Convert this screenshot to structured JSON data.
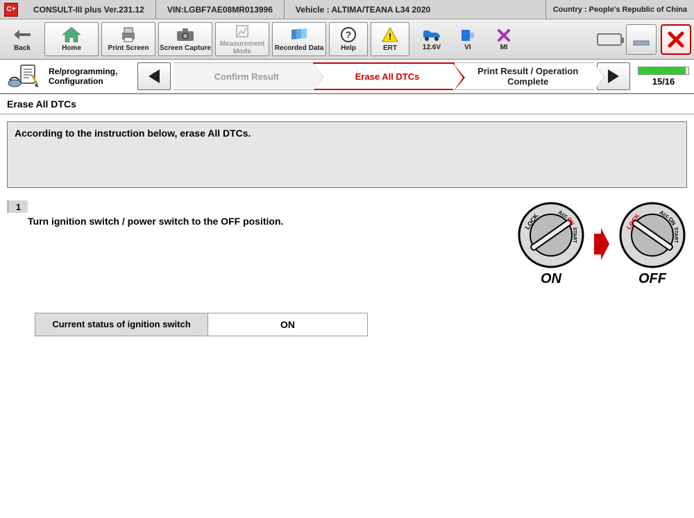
{
  "info_bar": {
    "app_icon": "C+",
    "app_name": "CONSULT-III plus  Ver.231.12",
    "vin": "VIN:LGBF7AE08MR013996",
    "vehicle": "Vehicle : ALTIMA/TEANA L34 2020",
    "country": "Country : People's Republic of China"
  },
  "toolbar": {
    "back": "Back",
    "home": "Home",
    "print_screen": "Print Screen",
    "screen_capture": "Screen Capture",
    "measurement_mode": "Measurement Mode",
    "recorded_data": "Recorded Data",
    "help": "Help",
    "ert": "ERT"
  },
  "status": {
    "voltage": "12.6V",
    "vi": "VI",
    "mi": "MI"
  },
  "wizard": {
    "task_label": "Re/programming, Configuration",
    "step_prev": "Confirm Result",
    "step_current": "Erase All DTCs",
    "step_next": "Print Result / Operation Complete",
    "progress": "15/16",
    "progress_pct": 94
  },
  "section": {
    "title": "Erase All DTCs"
  },
  "instruction": "According to the instruction below, erase All DTCs.",
  "step": {
    "number": "1",
    "text": "Turn ignition switch / power switch to the OFF position."
  },
  "dial_left_caption": "ON",
  "dial_right_caption": "OFF",
  "ignition_status": {
    "label": "Current status of ignition switch",
    "value": "ON"
  }
}
